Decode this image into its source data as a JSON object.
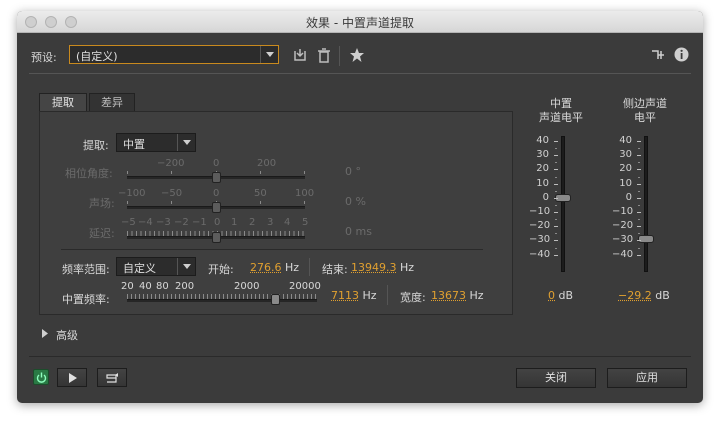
{
  "window": {
    "title": "效果 - 中置声道提取"
  },
  "preset": {
    "label": "预设:",
    "value": "(自定义)"
  },
  "tabs": [
    {
      "label": "提取"
    },
    {
      "label": "差异"
    }
  ],
  "extract": {
    "label": "提取:",
    "value": "中置"
  },
  "phase": {
    "label": "相位角度:",
    "ticks": [
      "−200",
      "0",
      "200"
    ],
    "value": "0",
    "unit": "°"
  },
  "pan": {
    "label": "声场:",
    "ticks": [
      "−100",
      "−50",
      "0",
      "50",
      "100"
    ],
    "value": "0",
    "unit": "%"
  },
  "delay": {
    "label": "延迟:",
    "ticks": [
      "−5",
      "−4",
      "−3",
      "−2",
      "−1",
      "0",
      "1",
      "2",
      "3",
      "4",
      "5"
    ],
    "value": "0",
    "unit": "ms"
  },
  "freq_range": {
    "label": "频率范围:",
    "value": "自定义",
    "start_label": "开始:",
    "start_value": "276.6",
    "start_unit": "Hz",
    "end_label": "结束:",
    "end_value": "13949.3",
    "end_unit": "Hz"
  },
  "center_freq": {
    "label": "中置频率:",
    "ticks": [
      "20",
      "40",
      "80",
      "200",
      "2000",
      "20000"
    ],
    "value": "7113",
    "unit": "Hz",
    "width_label": "宽度:",
    "width_value": "13673",
    "width_unit": "Hz"
  },
  "center_level": {
    "title_line1": "中置",
    "title_line2": "声道电平",
    "value": "0",
    "unit": "dB",
    "level_db": 0
  },
  "side_level": {
    "title_line1": "侧边声道",
    "title_line2": "电平",
    "value": "−29.2",
    "unit": "dB",
    "level_db": -29.2
  },
  "meter_scale": [
    "40",
    "30",
    "20",
    "10",
    "0",
    "−10",
    "−20",
    "−30",
    "−40"
  ],
  "advanced": {
    "label": "高级"
  },
  "footer": {
    "close_label": "关闭",
    "apply_label": "应用"
  },
  "colors": {
    "accent": "#e0a030",
    "power": "#3ecf6e"
  },
  "icons": [
    "save-preset-icon",
    "delete-preset-icon",
    "favorite-star-icon",
    "routing-icon",
    "info-icon",
    "power-icon",
    "play-icon",
    "loop-icon",
    "disclosure-triangle-icon"
  ]
}
